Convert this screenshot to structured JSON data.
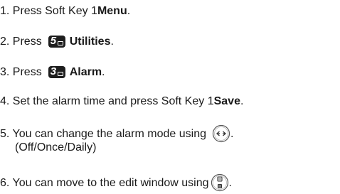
{
  "steps": [
    {
      "prefix": "1. Press Soft Key 1 ",
      "bold": "Menu",
      "suffix": "."
    },
    {
      "prefix": "2. Press",
      "key": "5",
      "bold": "Utilities",
      "suffix": "."
    },
    {
      "prefix": "3. Press",
      "key": "3",
      "bold": "Alarm",
      "suffix": "."
    },
    {
      "prefix": "4.  Set the alarm time and press Soft Key 1 ",
      "bold": "Save",
      "suffix": "."
    },
    {
      "prefix": "5.  You can change the alarm mode using",
      "icon": "left-right-nav-key-icon",
      "suffix": ".",
      "subline": "(Off/Once/Daily)"
    },
    {
      "prefix": "6.  You can move to the edit window using",
      "icon": "up-down-nav-key-icon",
      "suffix": "."
    }
  ]
}
